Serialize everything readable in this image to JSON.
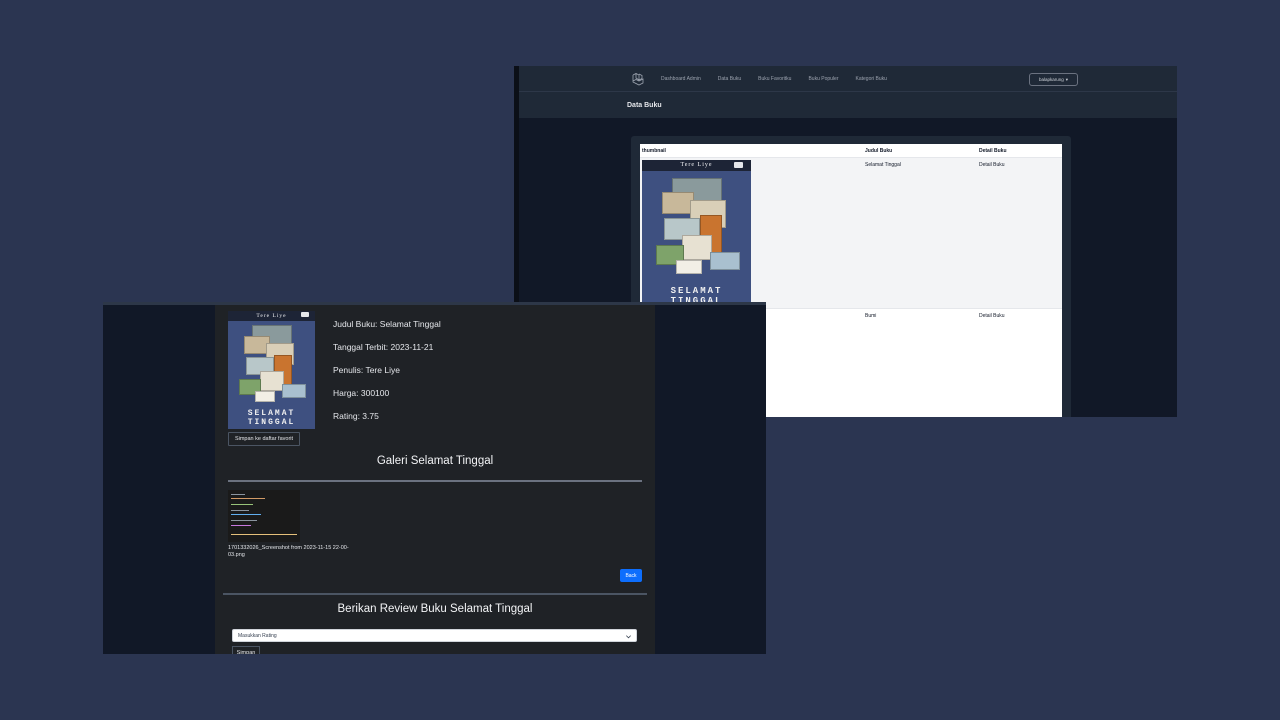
{
  "admin": {
    "nav": {
      "logo_icon": "laravel-logo-icon",
      "links": [
        "Dashboard Admin",
        "Data Buku",
        "Buku Favoritku",
        "Buku Populer",
        "Kategori Buku"
      ],
      "user_menu": "balapkarung"
    },
    "page_title": "Data Buku",
    "table": {
      "headers": [
        "thumbnail",
        "Judul Buku",
        "Detail Buku"
      ],
      "rows": [
        {
          "title": "Selamat Tinggal",
          "detail": "Detail Buku"
        },
        {
          "title": "Bumi",
          "detail": "Detail Buku"
        }
      ]
    }
  },
  "cover": {
    "author": "Tere Liye",
    "title_line1": "SELAMAT",
    "title_line2": "TINGGAL"
  },
  "detail": {
    "judul": "Judul Buku: Selamat Tinggal",
    "tanggal": "Tanggal Terbit: 2023-11-21",
    "penulis": "Penulis: Tere Liye",
    "harga": "Harga: 300100",
    "rating": "Rating: 3.75",
    "fav_button": "Simpan ke daftar favorit",
    "gallery_title": "Galeri Selamat Tinggal",
    "gallery_caption": "1701332026_Screenshot from 2023-11-15 22-00-03.png",
    "back_button": "Back",
    "review_title": "Berikan Review Buku Selamat Tinggal",
    "rating_placeholder": "Masukkan Rating",
    "save_button": "Simpan"
  },
  "colors": {
    "page_bg": "#2b3551",
    "window_bg": "#111827",
    "primary_button": "#0d6efd"
  }
}
